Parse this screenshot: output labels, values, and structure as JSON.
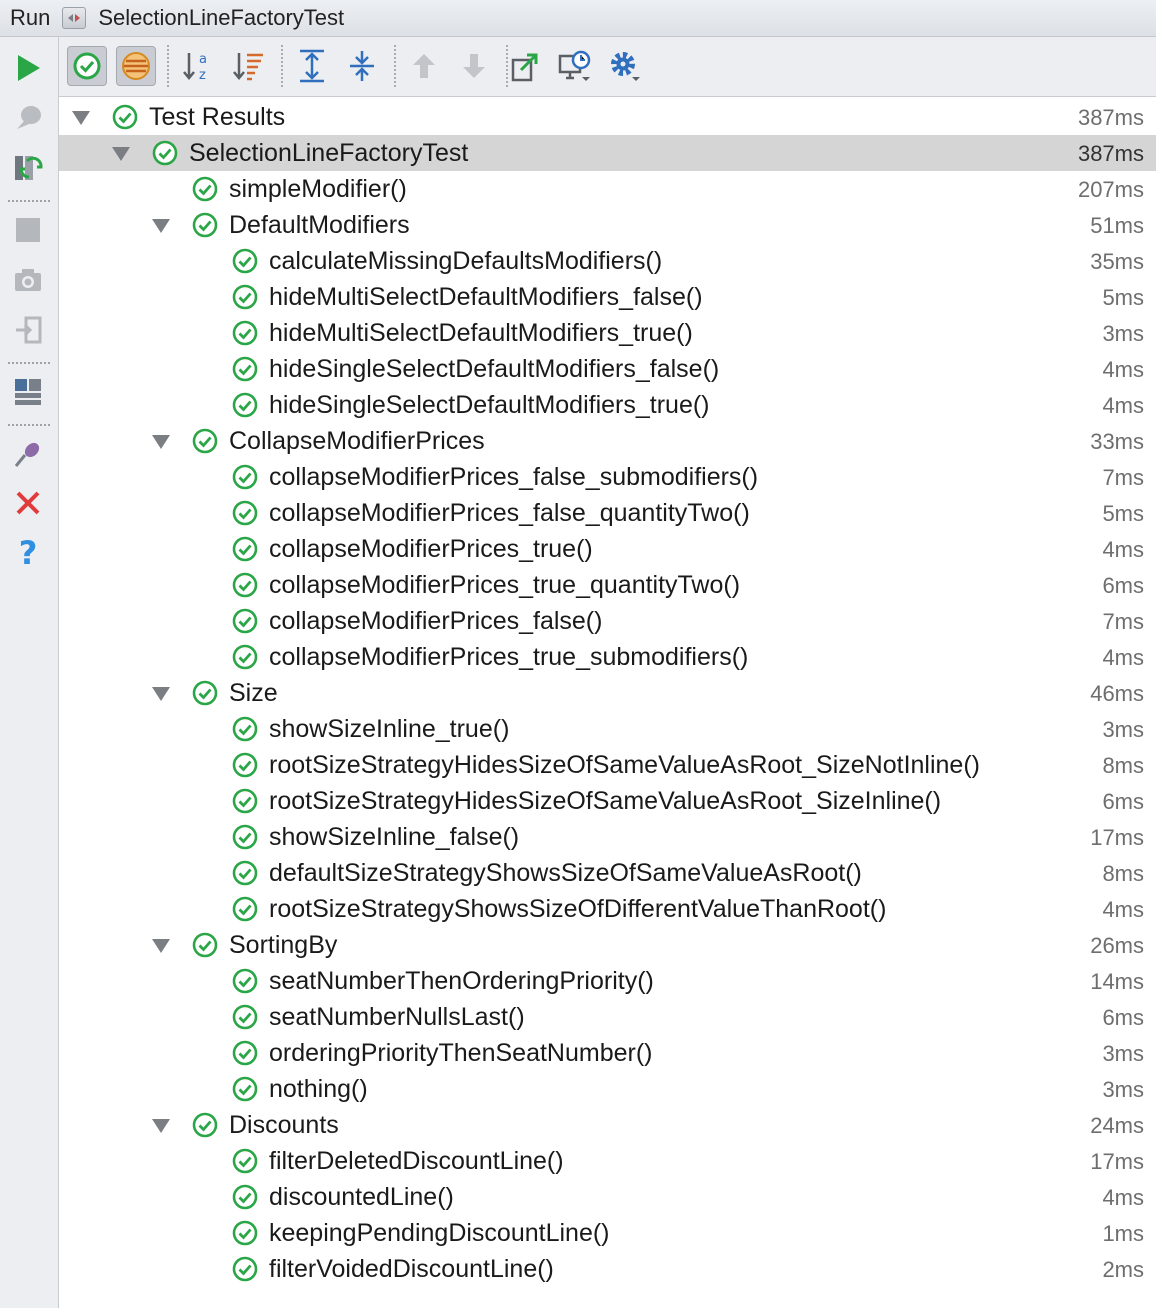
{
  "titlebar": {
    "run_label": "Run",
    "tab_title": "SelectionLineFactoryTest",
    "tab_icon": "run-config-icon"
  },
  "left_toolbar": {
    "items": [
      {
        "icon": "play-icon",
        "color": "#2aa647"
      },
      {
        "icon": "debug-icon"
      },
      {
        "icon": "rerun-failed-icon"
      },
      {
        "icon": "stop-icon"
      },
      {
        "icon": "camera-icon"
      },
      {
        "icon": "exit-icon"
      },
      {
        "icon": "layout-icon"
      },
      {
        "icon": "pin-icon"
      },
      {
        "icon": "close-icon",
        "color": "#e23b3b"
      },
      {
        "icon": "help-icon",
        "color": "#2f8fe0"
      }
    ]
  },
  "top_toolbar": {
    "items": [
      {
        "icon": "show-passed-icon",
        "pressed": true
      },
      {
        "icon": "show-ignored-icon",
        "pressed": true
      },
      {
        "icon": "sort-alpha-icon"
      },
      {
        "icon": "sort-duration-icon"
      },
      {
        "icon": "expand-all-icon"
      },
      {
        "icon": "collapse-all-icon"
      },
      {
        "icon": "previous-test-icon"
      },
      {
        "icon": "next-test-icon"
      },
      {
        "icon": "export-icon"
      },
      {
        "icon": "history-icon"
      },
      {
        "icon": "settings-icon"
      }
    ]
  },
  "colors": {
    "pass_green": "#2aa647",
    "selected_row": "#d5d5d5",
    "time_gray": "#6e6e6e"
  },
  "tree": [
    {
      "label": "Test Results",
      "time": "387ms",
      "level": 0,
      "expandable": true
    },
    {
      "label": "SelectionLineFactoryTest",
      "time": "387ms",
      "level": 1,
      "expandable": true,
      "selected": true
    },
    {
      "label": "simpleModifier()",
      "time": "207ms",
      "level": 2,
      "expandable": false
    },
    {
      "label": "DefaultModifiers",
      "time": "51ms",
      "level": 2,
      "expandable": true
    },
    {
      "label": "calculateMissingDefaultsModifiers()",
      "time": "35ms",
      "level": 3,
      "expandable": false
    },
    {
      "label": "hideMultiSelectDefaultModifiers_false()",
      "time": "5ms",
      "level": 3,
      "expandable": false
    },
    {
      "label": "hideMultiSelectDefaultModifiers_true()",
      "time": "3ms",
      "level": 3,
      "expandable": false
    },
    {
      "label": "hideSingleSelectDefaultModifiers_false()",
      "time": "4ms",
      "level": 3,
      "expandable": false
    },
    {
      "label": "hideSingleSelectDefaultModifiers_true()",
      "time": "4ms",
      "level": 3,
      "expandable": false
    },
    {
      "label": "CollapseModifierPrices",
      "time": "33ms",
      "level": 2,
      "expandable": true
    },
    {
      "label": "collapseModifierPrices_false_submodifiers()",
      "time": "7ms",
      "level": 3,
      "expandable": false
    },
    {
      "label": "collapseModifierPrices_false_quantityTwo()",
      "time": "5ms",
      "level": 3,
      "expandable": false
    },
    {
      "label": "collapseModifierPrices_true()",
      "time": "4ms",
      "level": 3,
      "expandable": false
    },
    {
      "label": "collapseModifierPrices_true_quantityTwo()",
      "time": "6ms",
      "level": 3,
      "expandable": false
    },
    {
      "label": "collapseModifierPrices_false()",
      "time": "7ms",
      "level": 3,
      "expandable": false
    },
    {
      "label": "collapseModifierPrices_true_submodifiers()",
      "time": "4ms",
      "level": 3,
      "expandable": false
    },
    {
      "label": "Size",
      "time": "46ms",
      "level": 2,
      "expandable": true
    },
    {
      "label": "showSizeInline_true()",
      "time": "3ms",
      "level": 3,
      "expandable": false
    },
    {
      "label": "rootSizeStrategyHidesSizeOfSameValueAsRoot_SizeNotInline()",
      "time": "8ms",
      "level": 3,
      "expandable": false
    },
    {
      "label": "rootSizeStrategyHidesSizeOfSameValueAsRoot_SizeInline()",
      "time": "6ms",
      "level": 3,
      "expandable": false
    },
    {
      "label": "showSizeInline_false()",
      "time": "17ms",
      "level": 3,
      "expandable": false
    },
    {
      "label": "defaultSizeStrategyShowsSizeOfSameValueAsRoot()",
      "time": "8ms",
      "level": 3,
      "expandable": false
    },
    {
      "label": "rootSizeStrategyShowsSizeOfDifferentValueThanRoot()",
      "time": "4ms",
      "level": 3,
      "expandable": false
    },
    {
      "label": "SortingBy",
      "time": "26ms",
      "level": 2,
      "expandable": true
    },
    {
      "label": "seatNumberThenOrderingPriority()",
      "time": "14ms",
      "level": 3,
      "expandable": false
    },
    {
      "label": "seatNumberNullsLast()",
      "time": "6ms",
      "level": 3,
      "expandable": false
    },
    {
      "label": "orderingPriorityThenSeatNumber()",
      "time": "3ms",
      "level": 3,
      "expandable": false
    },
    {
      "label": "nothing()",
      "time": "3ms",
      "level": 3,
      "expandable": false
    },
    {
      "label": "Discounts",
      "time": "24ms",
      "level": 2,
      "expandable": true
    },
    {
      "label": "filterDeletedDiscountLine()",
      "time": "17ms",
      "level": 3,
      "expandable": false
    },
    {
      "label": "discountedLine()",
      "time": "4ms",
      "level": 3,
      "expandable": false
    },
    {
      "label": "keepingPendingDiscountLine()",
      "time": "1ms",
      "level": 3,
      "expandable": false
    },
    {
      "label": "filterVoidedDiscountLine()",
      "time": "2ms",
      "level": 3,
      "expandable": false
    }
  ]
}
